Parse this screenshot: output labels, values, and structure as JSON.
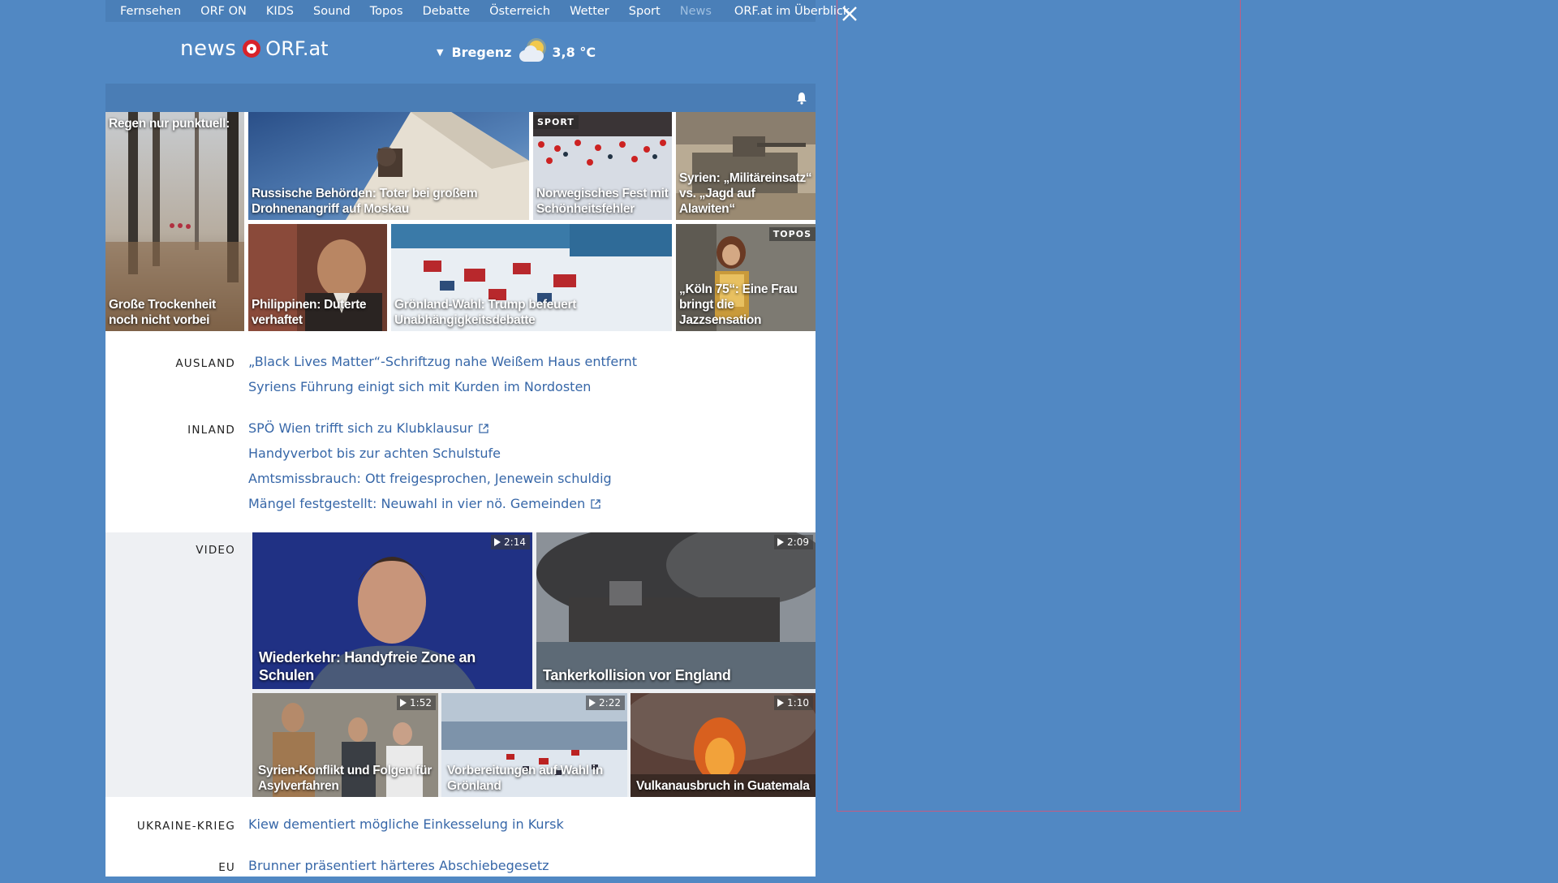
{
  "topnav": {
    "items": [
      "Fernsehen",
      "ORF ON",
      "KIDS",
      "Sound",
      "Topos",
      "Debatte",
      "Österreich",
      "Wetter",
      "Sport",
      "News"
    ],
    "overview": "ORF.at im Überblick"
  },
  "header": {
    "logo_news": "news",
    "logo_orf": "ORF.at",
    "weather_city": "Bregenz",
    "weather_temp": "3,8 °C"
  },
  "tiles": [
    {
      "top_text": "Regen nur punktuell:",
      "caption": "Große Trockenheit noch nicht vorbei"
    },
    {
      "caption": "Russische Behörden: Toter bei großem Drohnenangriff auf Moskau"
    },
    {
      "tag": "SPORT",
      "caption": "Norwegisches Fest mit Schönheitsfehler"
    },
    {
      "caption": "Syrien: „Militäreinsatz“ vs. „Jagd auf Alawiten“"
    },
    {
      "caption": "Philippinen: Duterte verhaftet"
    },
    {
      "caption": "Grönland-Wahl: Trump befeuert Unabhängigkeitsdebatte"
    },
    {
      "tag": "TOPOS",
      "caption": "„Köln 75“: Eine Frau bringt die Jazzsensation"
    }
  ],
  "sections": {
    "ausland": {
      "label": "AUSLAND",
      "links": [
        "„Black Lives Matter“-Schriftzug nahe Weißem Haus entfernt",
        "Syriens Führung einigt sich mit Kurden im Nordosten"
      ]
    },
    "inland": {
      "label": "INLAND",
      "links": [
        "SPÖ Wien trifft sich zu Klubklausur",
        "Handyverbot bis zur achten Schulstufe",
        "Amtsmissbrauch: Ott freigesprochen, Jenewein schuldig",
        "Mängel festgestellt: Neuwahl in vier nö. Gemeinden"
      ]
    },
    "video": {
      "label": "VIDEO",
      "items": [
        {
          "title": "Wiederkehr: Handyfreie Zone an Schulen",
          "duration": "2:14"
        },
        {
          "title": "Tankerkollision vor England",
          "duration": "2:09"
        },
        {
          "title": "Syrien-Konflikt und Folgen für Asylverfahren",
          "duration": "1:52"
        },
        {
          "title": "Vorbereitungen auf Wahl in Grönland",
          "duration": "2:22"
        },
        {
          "title": "Vulkanausbruch in Guatemala",
          "duration": "1:10"
        }
      ]
    },
    "ukraine": {
      "label": "UKRAINE-KRIEG",
      "links": [
        "Kiew dementiert mögliche Einkesselung in Kursk"
      ]
    },
    "eu": {
      "label": "EU",
      "links": [
        "Brunner präsentiert härteres Abschiebegesetz"
      ]
    }
  },
  "colors": {
    "page_bg": "#5188c3",
    "link": "#3767a8",
    "orf_red": "#d8232a"
  }
}
